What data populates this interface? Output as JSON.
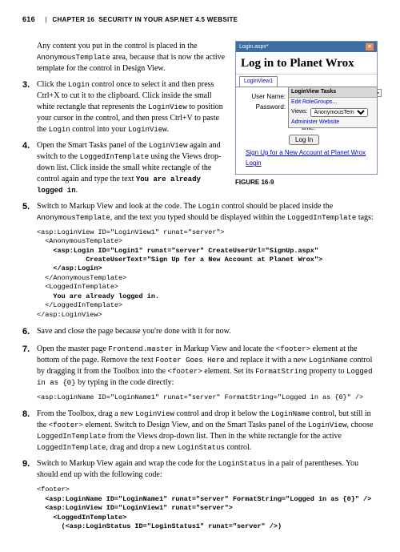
{
  "header": {
    "page": "616",
    "chapter": "CHAPTER 16",
    "title": "SECURITY IN YOUR ASP.NET 4.5 WEBSITE"
  },
  "intro": {
    "p1a": "Any content you put in the control is placed in the ",
    "p1b": "AnonymousTemplate",
    "p1c": " area, because that is now the active template for the control in Design View."
  },
  "s3": {
    "t1": "Click the ",
    "c1": "Login",
    "t2": " control once to select it and then press Ctrl+X to cut it to the clipboard. Click inside the small white rectangle that represents the ",
    "c2": "LoginView",
    "t3": " to position your cursor in the control, and then press Ctrl+V to paste the ",
    "c3": "Login",
    "t4": " control into your ",
    "c4": "LoginView",
    "t5": "."
  },
  "s4": {
    "t1": "Open the Smart Tasks panel of the ",
    "c1": "LoginView",
    "t2": " again and switch to the ",
    "c2": "LoggedInTemplate",
    "t3": " using the Views drop-down list. Click inside the small white rectangle of the control again and type the text ",
    "c3": "You are already logged in",
    "t4": "."
  },
  "s5": {
    "t1": "Switch to Markup View and look at the code. The ",
    "c1": "Login",
    "t2": " control should be placed inside the ",
    "c2": "AnonymousTemplate",
    "t3": ", and the text you typed should be displayed within the ",
    "c3": "LoggedInTemplate",
    "t4": " tags:"
  },
  "code5": "<asp:LoginView ID=\"LoginView1\" runat=\"server\">\n  <AnonymousTemplate>\n    <asp:Login ID=\"Login1\" runat=\"server\" CreateUserUrl=\"SignUp.aspx\"\n            CreateUserText=\"Sign Up for a New Account at Planet Wrox\">\n    </asp:Login>\n  </AnonymousTemplate>\n  <LoggedInTemplate>\n    You are already logged in.\n  </LoggedInTemplate>\n</asp:LoginView>",
  "s6": {
    "t1": "Save and close the page because you're done with it for now."
  },
  "s7": {
    "t1": "Open the master page ",
    "c1": "Frontend.master",
    "t2": " in Markup View and locate the ",
    "c2": "<footer>",
    "t3": " element at the bottom of the page. Remove the text ",
    "c3": "Footer Goes Here",
    "t4": " and replace it with a new ",
    "c4": "LoginName",
    "t5": " control by dragging it from the Toolbox into the ",
    "c5": "<footer>",
    "t6": " element. Set its ",
    "c6": "FormatString",
    "t7": " property to ",
    "c7": "Logged in as {0}",
    "t8": " by typing in the code directly:"
  },
  "code7": "<asp:LoginName ID=\"LoginName1\" runat=\"server\" FormatString=\"Logged in as {0}\" />",
  "s8": {
    "t1": "From the Toolbox, drag a new ",
    "c1": "LoginView",
    "t2": " control and drop it below the ",
    "c2": "LoginName",
    "t3": " control, but still in the ",
    "c3": "<footer>",
    "t4": " element. Switch to Design View, and on the Smart Tasks panel of the ",
    "c4": "LoginView",
    "t5": ", choose ",
    "c5": "LoggedInTemplate",
    "t6": " from the Views drop-down list. Then in the white rectangle for the active ",
    "c6": "LoggedInTemplate",
    "t7": ", drag and drop a new ",
    "c7": "LoginStatus",
    "t8": " control."
  },
  "s9": {
    "t1": "Switch to Markup View again and wrap the code for the ",
    "c1": "LoginStatus",
    "t2": " in a pair of parentheses. You should end up with the following code:"
  },
  "code9": "<footer>\n  <asp:LoginName ID=\"LoginName1\" runat=\"server\" FormatString=\"Logged in as {0}\" />\n  <asp:LoginView ID=\"LoginView1\" runat=\"server\">\n    <LoggedInTemplate>\n      (<asp:LoginStatus ID=\"LoginStatus1\" runat=\"server\" />)",
  "figure": {
    "caption": "FIGURE 16-9",
    "path": "Login.aspx*",
    "title": "Log in to Planet Wrox",
    "tab": "LoginView1",
    "tasksTitle": "LoginView Tasks",
    "editLink": "Edit RoleGroups...",
    "viewsLabel": "Views:",
    "viewsValue": "AnonymousTemplate",
    "adminLink": "Administer Website",
    "userLabel": "User Name:",
    "passLabel": "Password:",
    "remember": "Remember me next time.",
    "loginBtn": "Log In",
    "signup": "Sign Up for a New Account at Planet Wrox",
    "loginLink": "Login"
  }
}
